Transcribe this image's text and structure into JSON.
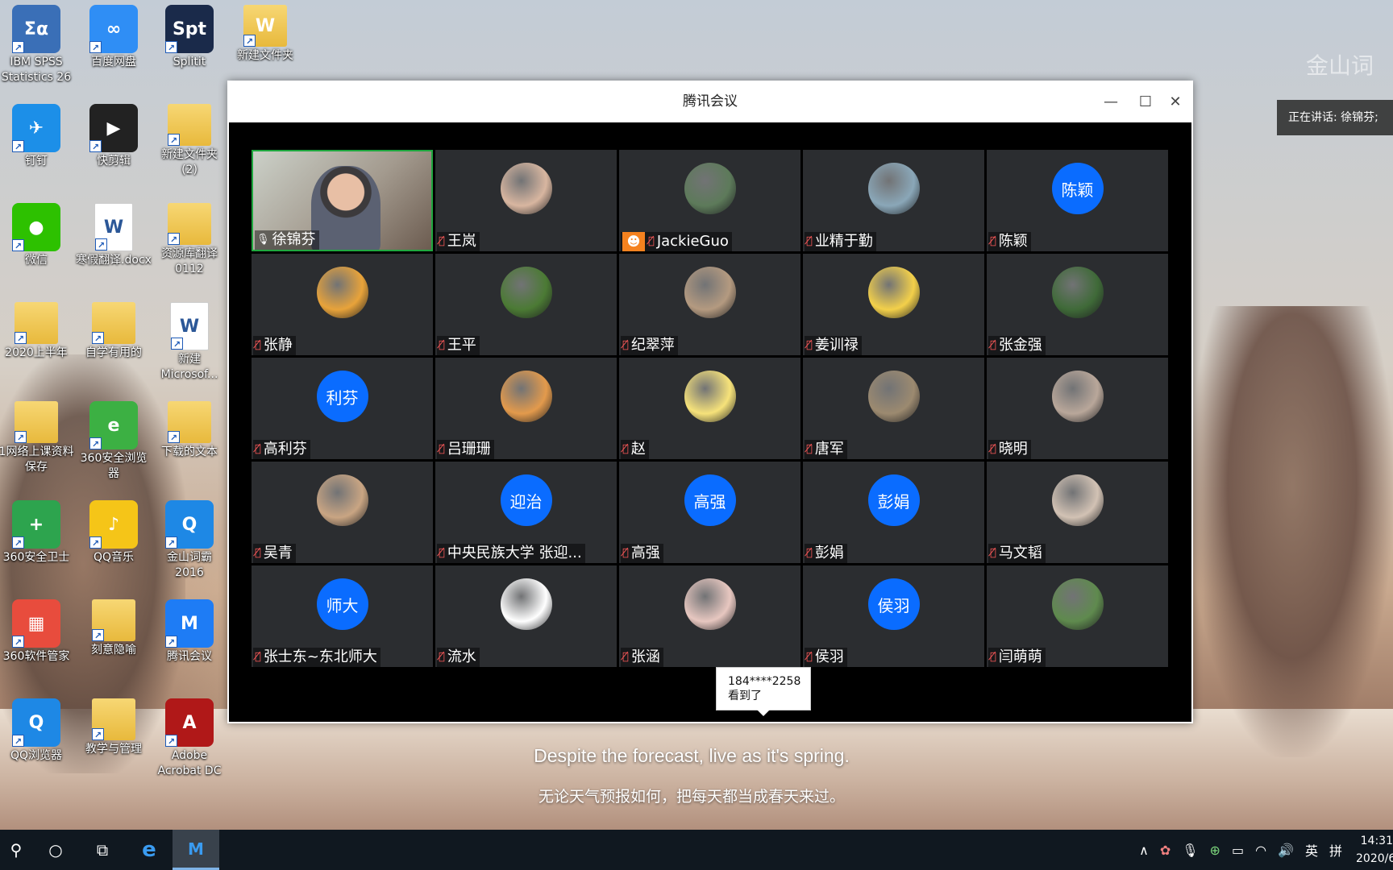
{
  "desktop": {
    "icons": [
      {
        "label": "IBM SPSS Statistics 26",
        "glyph": "Σα",
        "color": "#3a6fb7"
      },
      {
        "label": "百度网盘",
        "glyph": "∞",
        "color": "#2f8ef5"
      },
      {
        "label": "Splitit",
        "glyph": "Spt",
        "color": "#1a2a4a"
      },
      {
        "label": "新建文件夹",
        "glyph": "W",
        "color": "#e8b93c"
      },
      {
        "label": "钉钉",
        "glyph": "✈",
        "color": "#1c8fe8"
      },
      {
        "label": "快剪辑",
        "glyph": "▶",
        "color": "#222222"
      },
      {
        "label": "新建文件夹 (2)",
        "glyph": "",
        "color": "#e8b93c"
      },
      {
        "label": "微信",
        "glyph": "●",
        "color": "#2dc100"
      },
      {
        "label": "寒假翻译.docx",
        "glyph": "W",
        "color": "#ffffff"
      },
      {
        "label": "资源库翻译0112",
        "glyph": "",
        "color": "#e8b93c"
      },
      {
        "label": "2020上半年",
        "glyph": "",
        "color": "#e8b93c"
      },
      {
        "label": "自学有用的",
        "glyph": "",
        "color": "#e8b93c"
      },
      {
        "label": "新建 Microsof...",
        "glyph": "W",
        "color": "#ffffff"
      },
      {
        "label": "1网络上课资料保存",
        "glyph": "",
        "color": "#e8b93c"
      },
      {
        "label": "360安全浏览器",
        "glyph": "e",
        "color": "#3cb043"
      },
      {
        "label": "下载的文本",
        "glyph": "",
        "color": "#e8b93c"
      },
      {
        "label": "360安全卫士",
        "glyph": "+",
        "color": "#2da44e"
      },
      {
        "label": "QQ音乐",
        "glyph": "♪",
        "color": "#f5c518"
      },
      {
        "label": "金山词霸 2016",
        "glyph": "Q",
        "color": "#1e88e5"
      },
      {
        "label": "360软件管家",
        "glyph": "▦",
        "color": "#e84c3d"
      },
      {
        "label": "刻意隐喻",
        "glyph": "",
        "color": "#e8b93c"
      },
      {
        "label": "腾讯会议",
        "glyph": "M",
        "color": "#1e7cf5"
      },
      {
        "label": "QQ浏览器",
        "glyph": "Q",
        "color": "#1e88e5"
      },
      {
        "label": "教学与管理",
        "glyph": "",
        "color": "#e8b93c"
      },
      {
        "label": "Adobe Acrobat DC",
        "glyph": "A",
        "color": "#b01818"
      }
    ],
    "watermark": "金山词",
    "speaking": "正在讲话: 徐锦芬;",
    "quote_en": "Despite the forecast, live as it's spring.",
    "quote_cn": "无论天气预报如何，把每天都当成春天来过。"
  },
  "window": {
    "title": "腾讯会议",
    "minimize_icon": "—",
    "maximize_icon": "☐",
    "close_icon": "✕"
  },
  "participants": [
    {
      "name": "徐锦芬",
      "avatar": "video",
      "muted": false,
      "active": true
    },
    {
      "name": "王岚",
      "avatar": "photo",
      "color": "#d8b6a0",
      "muted": true
    },
    {
      "name": "JackieGuo",
      "avatar": "photo",
      "color": "#5d7a5a",
      "muted": true,
      "host": true
    },
    {
      "name": "业精于勤",
      "avatar": "photo",
      "color": "#8aa7b8",
      "muted": true
    },
    {
      "name": "陈颖",
      "avatar": "text",
      "avatar_text": "陈颖",
      "muted": true
    },
    {
      "name": "张静",
      "avatar": "photo",
      "color": "#e8a33a",
      "muted": true
    },
    {
      "name": "王平",
      "avatar": "photo",
      "color": "#4b7a34",
      "muted": true
    },
    {
      "name": "纪翠萍",
      "avatar": "photo",
      "color": "#b49a80",
      "muted": true
    },
    {
      "name": "姜训禄",
      "avatar": "photo",
      "color": "#f3d04a",
      "muted": true
    },
    {
      "name": "张金强",
      "avatar": "photo",
      "color": "#3f6a38",
      "muted": true
    },
    {
      "name": "高利芬",
      "avatar": "text",
      "avatar_text": "利芬",
      "muted": true
    },
    {
      "name": "吕珊珊",
      "avatar": "photo",
      "color": "#e39a4c",
      "muted": true
    },
    {
      "name": "赵",
      "avatar": "photo",
      "color": "#f6e27a",
      "muted": true
    },
    {
      "name": "唐军",
      "avatar": "photo",
      "color": "#9c8a70",
      "muted": true
    },
    {
      "name": "晓明",
      "avatar": "photo",
      "color": "#b9a79a",
      "muted": true
    },
    {
      "name": "吴青",
      "avatar": "photo",
      "color": "#c9a583",
      "muted": true
    },
    {
      "name": "中央民族大学 张迎...",
      "avatar": "text",
      "avatar_text": "迎治",
      "muted": true
    },
    {
      "name": "高强",
      "avatar": "text",
      "avatar_text": "高强",
      "muted": true
    },
    {
      "name": "彭娟",
      "avatar": "text",
      "avatar_text": "彭娟",
      "muted": true
    },
    {
      "name": "马文韬",
      "avatar": "photo",
      "color": "#d2c2b4",
      "muted": true
    },
    {
      "name": "张士东~东北师大",
      "avatar": "text",
      "avatar_text": "师大",
      "muted": true
    },
    {
      "name": "流水",
      "avatar": "photo",
      "color": "#ffffff",
      "muted": true
    },
    {
      "name": "张涵",
      "avatar": "photo",
      "color": "#e7c7c0",
      "muted": true
    },
    {
      "name": "侯羽",
      "avatar": "text",
      "avatar_text": "侯羽",
      "muted": true
    },
    {
      "name": "闫萌萌",
      "avatar": "photo",
      "color": "#5f8a4e",
      "muted": true
    }
  ],
  "tooltip": {
    "line1": "184****2258",
    "line2": "看到了"
  },
  "taskbar": {
    "search_icon": "⚲",
    "cortana_icon": "○",
    "taskview_icon": "⧉",
    "edge_icon": "e",
    "meeting_icon": "M",
    "ime_lang": "英",
    "ime_mode": "拼",
    "time": "14:31",
    "date": "2020/6/"
  }
}
